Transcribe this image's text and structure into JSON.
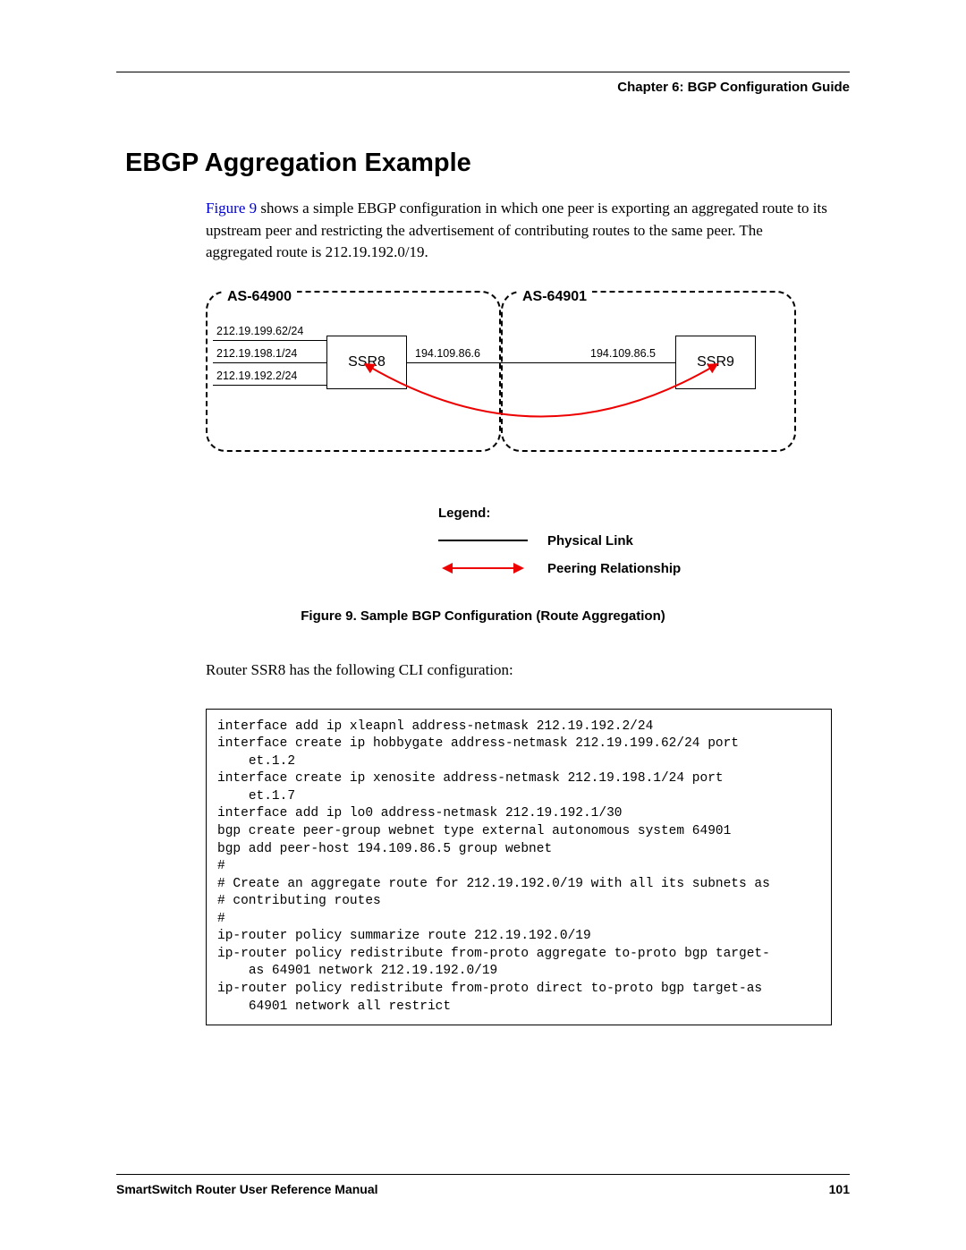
{
  "header": {
    "chapter": "Chapter 6: BGP Configuration Guide"
  },
  "section": {
    "title": "EBGP Aggregation Example"
  },
  "intro": {
    "link_text": "Figure 9",
    "rest": " shows a simple EBGP configuration in which one peer is exporting an aggregated route to its upstream peer and restricting the advertisement of contributing routes to the same peer. The aggregated route is 212.19.192.0/19."
  },
  "diagram": {
    "as_left": "AS-64900",
    "as_right": "AS-64901",
    "ssr8": "SSR8",
    "ssr9": "SSR9",
    "ip1": "212.19.199.62/24",
    "ip2": "212.19.198.1/24",
    "ip3": "212.19.192.2/24",
    "link_left": "194.109.86.6",
    "link_right": "194.109.86.5"
  },
  "legend": {
    "title": "Legend:",
    "physical": "Physical Link",
    "peering": "Peering Relationship"
  },
  "figure_caption": "Figure 9.  Sample BGP Configuration (Route Aggregation)",
  "cli_intro": "Router SSR8 has the following CLI configuration:",
  "cli": "interface add ip xleapnl address-netmask 212.19.192.2/24\ninterface create ip hobbygate address-netmask 212.19.199.62/24 port\n    et.1.2\ninterface create ip xenosite address-netmask 212.19.198.1/24 port\n    et.1.7\ninterface add ip lo0 address-netmask 212.19.192.1/30\nbgp create peer-group webnet type external autonomous system 64901\nbgp add peer-host 194.109.86.5 group webnet\n#\n# Create an aggregate route for 212.19.192.0/19 with all its subnets as\n# contributing routes\n#\nip-router policy summarize route 212.19.192.0/19\nip-router policy redistribute from-proto aggregate to-proto bgp target-\n    as 64901 network 212.19.192.0/19\nip-router policy redistribute from-proto direct to-proto bgp target-as\n    64901 network all restrict",
  "footer": {
    "manual": "SmartSwitch Router User Reference Manual",
    "page": "101"
  }
}
